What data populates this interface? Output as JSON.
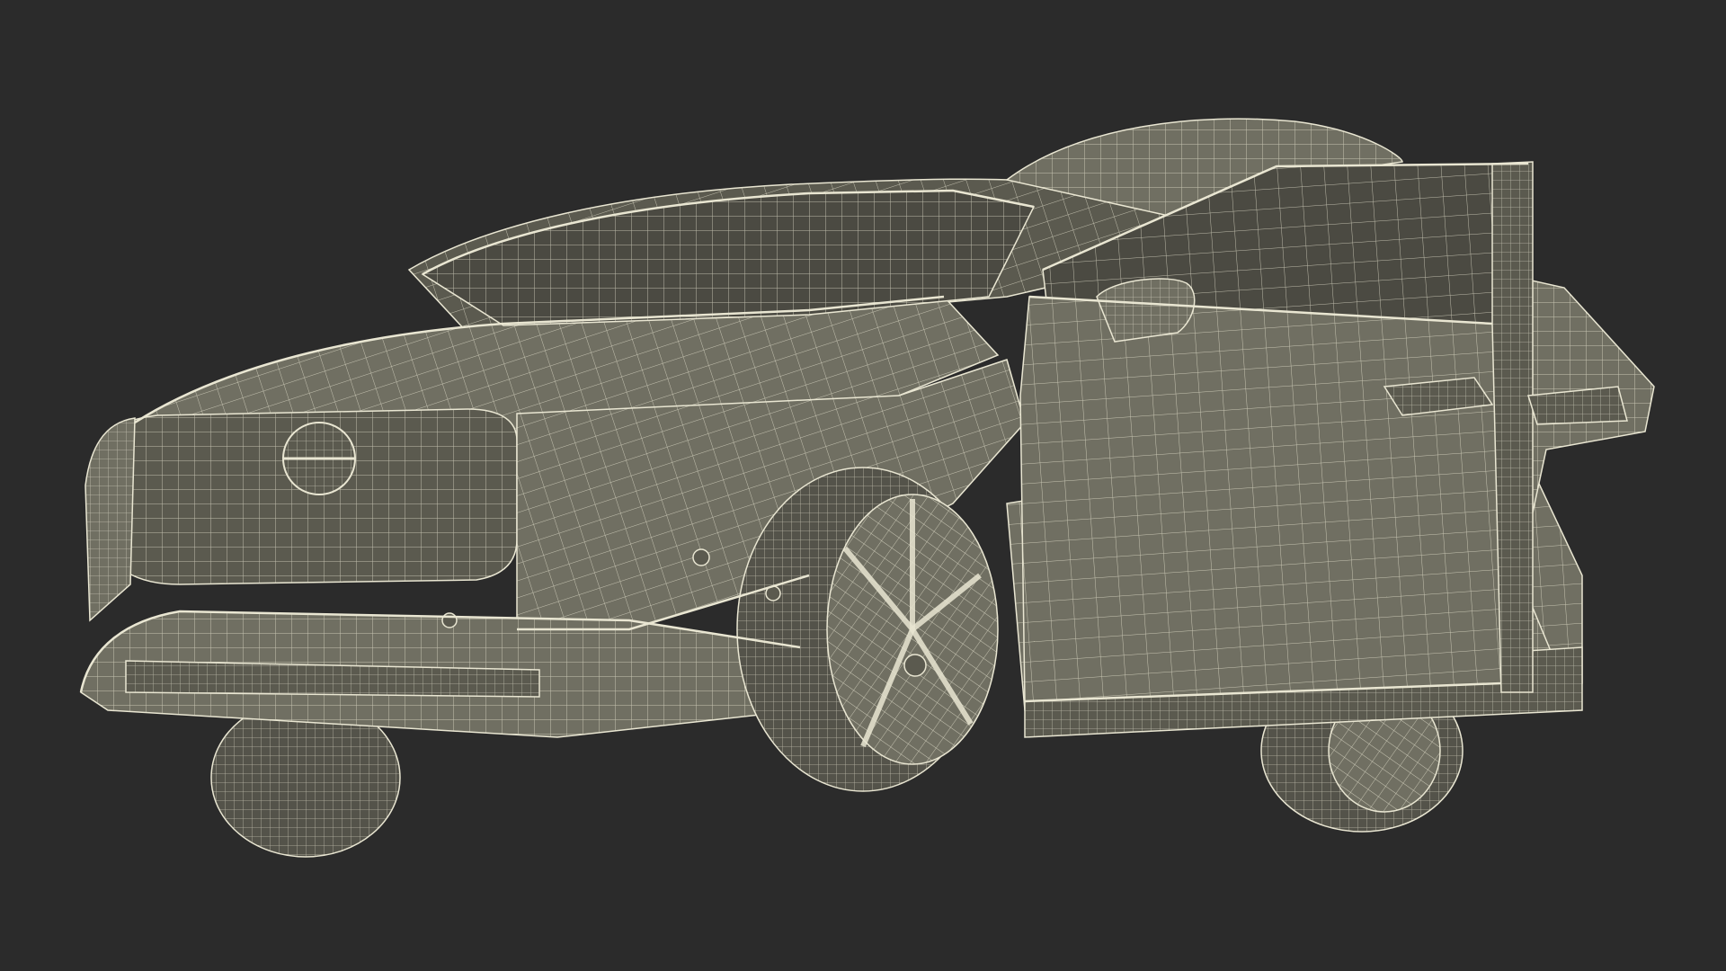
{
  "scene": {
    "subject": "car-wireframe",
    "background_color": "#2b2b2b",
    "body_color": "#706f62",
    "body_dark_color": "#5b5a4f",
    "glass_color": "#4b4a42",
    "tire_color": "#54534a",
    "wire_color": "#e9e6d2"
  }
}
